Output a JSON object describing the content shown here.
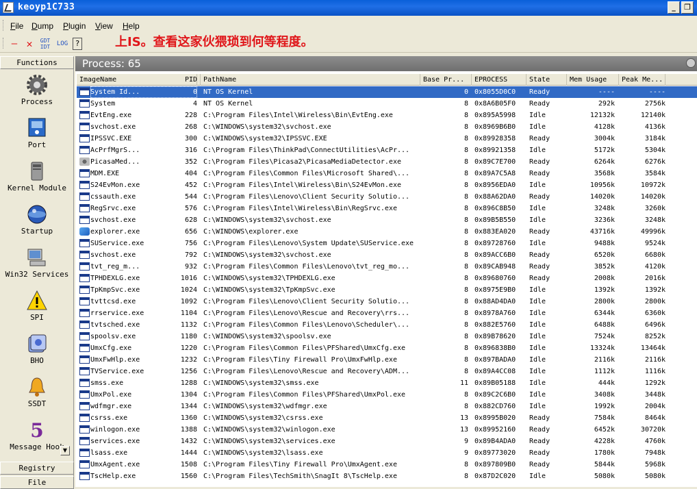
{
  "window": {
    "title": "keoyp1C733"
  },
  "menu": [
    {
      "u": "F",
      "rest": "ile"
    },
    {
      "u": "D",
      "rest": "ump"
    },
    {
      "u": "P",
      "rest": "lugin"
    },
    {
      "u": "V",
      "rest": "iew"
    },
    {
      "u": "H",
      "rest": "elp"
    }
  ],
  "toolbar": {
    "minimize_label": "—",
    "close_label": "✕",
    "gdt_idt_label": "GDT IDT",
    "log_label": "LOG",
    "help_label": "?"
  },
  "banner": "上IS。查看这家伙猥琐到何等程度。",
  "left_panel": {
    "header": "Functions",
    "items": [
      {
        "label": "Process",
        "icon": "gear-icon"
      },
      {
        "label": "Port",
        "icon": "port-icon"
      },
      {
        "label": "Kernel Module",
        "icon": "module-icon"
      },
      {
        "label": "Startup",
        "icon": "startup-icon"
      },
      {
        "label": "Win32 Services",
        "icon": "computer-icon"
      },
      {
        "label": "SPI",
        "icon": "warning-icon"
      },
      {
        "label": "BHO",
        "icon": "folder-icon"
      },
      {
        "label": "SSDT",
        "icon": "bell-icon"
      },
      {
        "label": "Message Hook",
        "icon": "hook-icon"
      }
    ],
    "footer_tabs": [
      "Registry",
      "File"
    ]
  },
  "process_header": "Process: 65",
  "columns": [
    "ImageName",
    "PID",
    "PathName",
    "Base Pr...",
    "EPROCESS",
    "State",
    "Mem Usage",
    "Peak Me..."
  ],
  "rows": [
    [
      "System Id...",
      "0",
      "NT OS Kernel",
      "0",
      "0x8055D0C0",
      "Ready",
      "----",
      "----"
    ],
    [
      "System",
      "4",
      "NT OS Kernel",
      "8",
      "0x8A6B05F0",
      "Ready",
      "292k",
      "2756k"
    ],
    [
      "EvtEng.exe",
      "228",
      "C:\\Program Files\\Intel\\Wireless\\Bin\\EvtEng.exe",
      "8",
      "0x895A5998",
      "Idle",
      "12132k",
      "12140k"
    ],
    [
      "svchost.exe",
      "268",
      "C:\\WINDOWS\\system32\\svchost.exe",
      "8",
      "0x8969B6B0",
      "Idle",
      "4128k",
      "4136k"
    ],
    [
      "IPSSVC.EXE",
      "300",
      "C:\\WINDOWS\\system32\\IPSSVC.EXE",
      "8",
      "0x89928358",
      "Ready",
      "3004k",
      "3184k"
    ],
    [
      "AcPrfMgrS...",
      "316",
      "C:\\Program Files\\ThinkPad\\ConnectUtilities\\AcPr...",
      "8",
      "0x89921358",
      "Idle",
      "5172k",
      "5304k"
    ],
    [
      "PicasaMed...",
      "352",
      "C:\\Program Files\\Picasa2\\PicasaMediaDetector.exe",
      "8",
      "0x89C7E700",
      "Ready",
      "6264k",
      "6276k"
    ],
    [
      "MDM.EXE",
      "404",
      "C:\\Program Files\\Common Files\\Microsoft Shared\\...",
      "8",
      "0x89A7C5A8",
      "Ready",
      "3568k",
      "3584k"
    ],
    [
      "S24EvMon.exe",
      "452",
      "C:\\Program Files\\Intel\\Wireless\\Bin\\S24EvMon.exe",
      "8",
      "0x8956EDA0",
      "Idle",
      "10956k",
      "10972k"
    ],
    [
      "cssauth.exe",
      "544",
      "C:\\Program Files\\Lenovo\\Client Security Solutio...",
      "8",
      "0x88A62DA0",
      "Ready",
      "14020k",
      "14020k"
    ],
    [
      "RegSrvc.exe",
      "576",
      "C:\\Program Files\\Intel\\Wireless\\Bin\\RegSrvc.exe",
      "8",
      "0x896C8B50",
      "Idle",
      "3248k",
      "3260k"
    ],
    [
      "svchost.exe",
      "628",
      "C:\\WINDOWS\\system32\\svchost.exe",
      "8",
      "0x89B5B550",
      "Idle",
      "3236k",
      "3248k"
    ],
    [
      "explorer.exe",
      "656",
      "C:\\WINDOWS\\explorer.exe",
      "8",
      "0x883EA020",
      "Ready",
      "43716k",
      "49996k"
    ],
    [
      "SUService.exe",
      "756",
      "C:\\Program Files\\Lenovo\\System Update\\SUService.exe",
      "8",
      "0x89728760",
      "Idle",
      "9488k",
      "9524k"
    ],
    [
      "svchost.exe",
      "792",
      "C:\\WINDOWS\\system32\\svchost.exe",
      "8",
      "0x89ACC6B0",
      "Ready",
      "6520k",
      "6680k"
    ],
    [
      "tvt_reg_m...",
      "932",
      "C:\\Program Files\\Common Files\\Lenovo\\tvt_reg_mo...",
      "8",
      "0x89CAB948",
      "Ready",
      "3852k",
      "4120k"
    ],
    [
      "TPHDEXLG.exe",
      "1016",
      "C:\\WINDOWS\\system32\\TPHDEXLG.exe",
      "8",
      "0x89680760",
      "Ready",
      "2008k",
      "2016k"
    ],
    [
      "TpKmpSvc.exe",
      "1024",
      "C:\\WINDOWS\\system32\\TpKmpSvc.exe",
      "8",
      "0x8975E9B0",
      "Idle",
      "1392k",
      "1392k"
    ],
    [
      "tvttcsd.exe",
      "1092",
      "C:\\Program Files\\Lenovo\\Client Security Solutio...",
      "8",
      "0x88AD4DA0",
      "Idle",
      "2800k",
      "2800k"
    ],
    [
      "rrservice.exe",
      "1104",
      "C:\\Program Files\\Lenovo\\Rescue and Recovery\\rrs...",
      "8",
      "0x8978A760",
      "Idle",
      "6344k",
      "6360k"
    ],
    [
      "tvtsched.exe",
      "1132",
      "C:\\Program Files\\Common Files\\Lenovo\\Scheduler\\...",
      "8",
      "0x882E5760",
      "Idle",
      "6488k",
      "6496k"
    ],
    [
      "spoolsv.exe",
      "1180",
      "C:\\WINDOWS\\system32\\spoolsv.exe",
      "8",
      "0x89B78620",
      "Idle",
      "7524k",
      "8252k"
    ],
    [
      "UmxCfg.exe",
      "1220",
      "C:\\Program Files\\Common Files\\PFShared\\UmxCfg.exe",
      "8",
      "0x896838B0",
      "Idle",
      "13324k",
      "13464k"
    ],
    [
      "UmxFwHlp.exe",
      "1232",
      "C:\\Program Files\\Tiny Firewall Pro\\UmxFwHlp.exe",
      "8",
      "0x897BADA0",
      "Idle",
      "2116k",
      "2116k"
    ],
    [
      "TVService.exe",
      "1256",
      "C:\\Program Files\\Lenovo\\Rescue and Recovery\\ADM...",
      "8",
      "0x89A4CC08",
      "Idle",
      "1112k",
      "1116k"
    ],
    [
      "smss.exe",
      "1288",
      "C:\\WINDOWS\\system32\\smss.exe",
      "11",
      "0x89B05188",
      "Idle",
      "444k",
      "1292k"
    ],
    [
      "UmxPol.exe",
      "1304",
      "C:\\Program Files\\Common Files\\PFShared\\UmxPol.exe",
      "8",
      "0x89C2C6B0",
      "Idle",
      "3408k",
      "3448k"
    ],
    [
      "wdfmgr.exe",
      "1344",
      "C:\\WINDOWS\\system32\\wdfmgr.exe",
      "8",
      "0x882CD760",
      "Idle",
      "1992k",
      "2004k"
    ],
    [
      "csrss.exe",
      "1360",
      "C:\\WINDOWS\\system32\\csrss.exe",
      "13",
      "0x8995B020",
      "Ready",
      "7584k",
      "8464k"
    ],
    [
      "winlogon.exe",
      "1388",
      "C:\\WINDOWS\\system32\\winlogon.exe",
      "13",
      "0x89952160",
      "Ready",
      "6452k",
      "30720k"
    ],
    [
      "services.exe",
      "1432",
      "C:\\WINDOWS\\system32\\services.exe",
      "9",
      "0x89B4ADA0",
      "Ready",
      "4228k",
      "4760k"
    ],
    [
      "lsass.exe",
      "1444",
      "C:\\WINDOWS\\system32\\lsass.exe",
      "9",
      "0x89773020",
      "Ready",
      "1780k",
      "7948k"
    ],
    [
      "UmxAgent.exe",
      "1508",
      "C:\\Program Files\\Tiny Firewall Pro\\UmxAgent.exe",
      "8",
      "0x897809B0",
      "Ready",
      "5844k",
      "5968k"
    ],
    [
      "TscHelp.exe",
      "1560",
      "C:\\Program Files\\TechSmith\\SnagIt 8\\TscHelp.exe",
      "8",
      "0x87D2C020",
      "Idle",
      "5080k",
      "5080k"
    ]
  ],
  "selected_row": 0,
  "colors": {
    "selection": "#316ac5",
    "titlebar": "#0a52c6",
    "banner": "#e0161a"
  }
}
